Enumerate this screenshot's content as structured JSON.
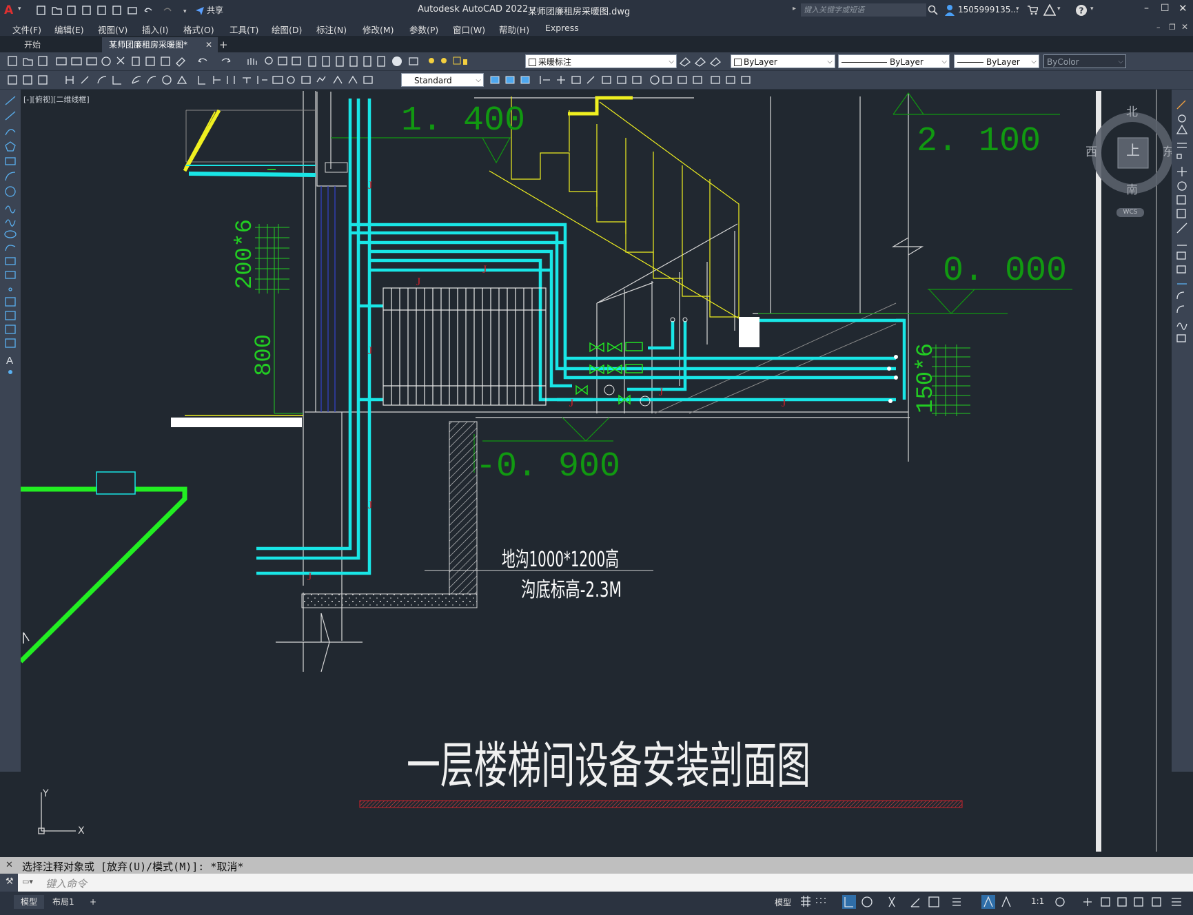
{
  "titlebar": {
    "app_title": "Autodesk AutoCAD 2022",
    "file_name": "某师团廉租房采暖图.dwg",
    "search_placeholder": "键入关键字或短语",
    "user": "1505999135...",
    "share_label": "共享"
  },
  "menu": [
    "文件(F)",
    "编辑(E)",
    "视图(V)",
    "插入(I)",
    "格式(O)",
    "工具(T)",
    "绘图(D)",
    "标注(N)",
    "修改(M)",
    "参数(P)",
    "窗口(W)",
    "帮助(H)",
    "Express"
  ],
  "tabs": {
    "start": "开始",
    "drawing": "某师团廉租房采暖图*",
    "add": "+"
  },
  "toolbar": {
    "layer": "采暖标注",
    "color": "ByLayer",
    "linetype": "ByLayer",
    "lineweight": "ByLayer",
    "plotstyle": "ByColor",
    "textstyle": "Standard"
  },
  "viewport": {
    "label": "[-][俯视][二维线框]",
    "compass": {
      "north": "北",
      "south": "南",
      "east": "东",
      "west": "西",
      "top": "上",
      "wcs": "WCS"
    },
    "ucs": {
      "x": "X",
      "y": "Y"
    }
  },
  "drawing": {
    "elev_1400": "1. 400",
    "elev_2100": "2. 100",
    "elev_0000": "0. 000",
    "elev_m0900": "-0. 900",
    "dim_200x6": "200*6",
    "dim_800": "800",
    "dim_150x6": "150*6",
    "note_trench": "地沟1000*1200高",
    "note_bottom": "沟底标高-2.3M",
    "title": "一层楼梯间设备安装剖面图",
    "pipe_tag": "J"
  },
  "command": {
    "history": "选择注释对象或 [放弃(U)/模式(M)]: *取消*",
    "placeholder": "键入命令"
  },
  "layouts": {
    "model": "模型",
    "layout1": "布局1",
    "add": "+"
  },
  "status": {
    "model": "模型",
    "scale": "1:1"
  },
  "colors": {
    "cyan": "#19e6e6",
    "yellow": "#f0f020",
    "green": "#119911",
    "bright_green": "#22ee22",
    "red": "#d0202a"
  }
}
